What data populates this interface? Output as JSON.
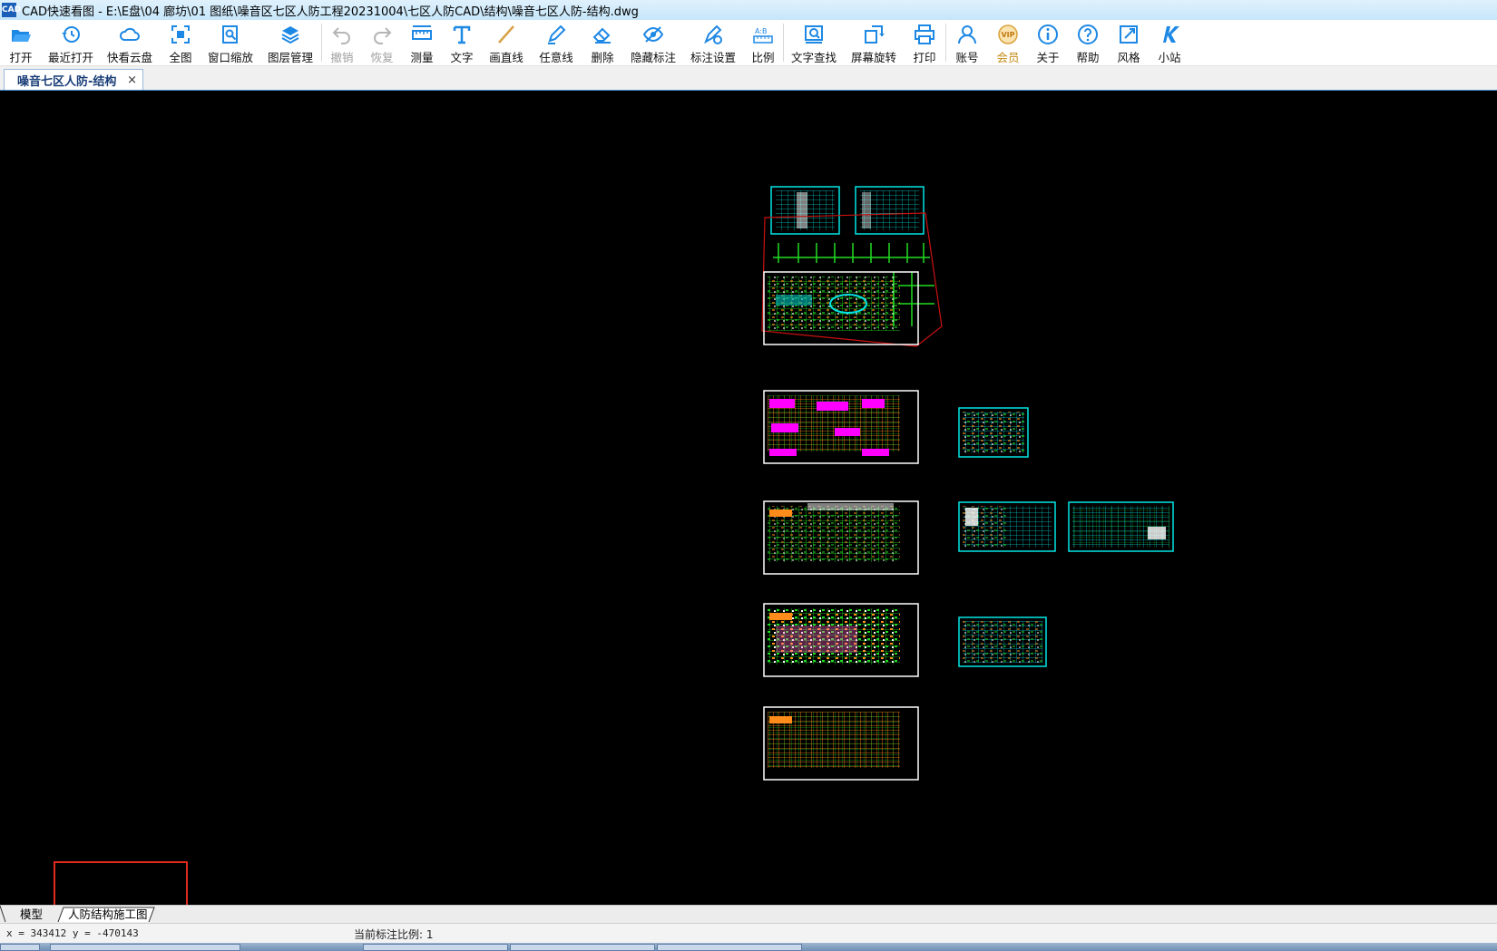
{
  "window": {
    "app_icon": "CAD",
    "title": "CAD快速看图 - E:\\E盘\\04 廊坊\\01 图纸\\噪音区七区人防工程20231004\\七区人防CAD\\结构\\噪音七区人防-结构.dwg"
  },
  "toolbar": {
    "items": [
      {
        "label": "打开",
        "icon": "folder-open-icon"
      },
      {
        "label": "最近打开",
        "icon": "history-icon"
      },
      {
        "label": "快看云盘",
        "icon": "cloud-icon"
      },
      {
        "label": "全图",
        "icon": "fit-all-icon"
      },
      {
        "label": "窗口缩放",
        "icon": "window-zoom-icon"
      },
      {
        "label": "图层管理",
        "icon": "layers-icon"
      },
      {
        "label": "撤销",
        "icon": "undo-icon"
      },
      {
        "label": "恢复",
        "icon": "redo-icon"
      },
      {
        "label": "测量",
        "icon": "measure-icon"
      },
      {
        "label": "文字",
        "icon": "text-icon"
      },
      {
        "label": "画直线",
        "icon": "line-icon"
      },
      {
        "label": "任意线",
        "icon": "pencil-icon"
      },
      {
        "label": "删除",
        "icon": "eraser-icon"
      },
      {
        "label": "隐藏标注",
        "icon": "hide-eye-icon"
      },
      {
        "label": "标注设置",
        "icon": "annotation-settings-icon"
      },
      {
        "label": "比例",
        "icon": "scale-icon"
      },
      {
        "label": "文字查找",
        "icon": "text-search-icon"
      },
      {
        "label": "屏幕旋转",
        "icon": "rotate-screen-icon"
      },
      {
        "label": "打印",
        "icon": "printer-icon"
      },
      {
        "label": "账号",
        "icon": "user-icon"
      },
      {
        "label": "会员",
        "icon": "vip-icon"
      },
      {
        "label": "关于",
        "icon": "info-icon"
      },
      {
        "label": "帮助",
        "icon": "help-icon"
      },
      {
        "label": "风格",
        "icon": "style-icon"
      },
      {
        "label": "小站",
        "icon": "k-logo-icon"
      }
    ],
    "vip_badge": "VIP"
  },
  "document_tab": {
    "label": "噪音七区人防-结构",
    "close": "×"
  },
  "layout_tabs": {
    "model": "模型",
    "layout1": "人防结构施工图"
  },
  "status": {
    "coordinates": "x = 343412 y = -470143",
    "scale_label": "当前标注比例: 1"
  },
  "colors": {
    "canvas_bg": "#000000",
    "accent_blue": "#1e88e5",
    "highlight_red": "#e02a1e",
    "drawing_cyan": "#00e5e5",
    "drawing_green": "#22dd22",
    "drawing_magenta": "#ff00ff",
    "drawing_orange": "#ff8c1a"
  }
}
